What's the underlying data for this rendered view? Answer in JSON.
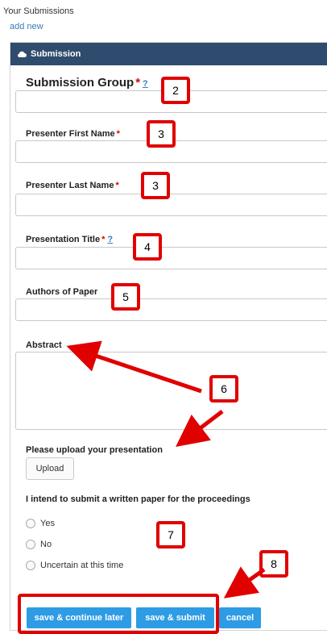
{
  "page": {
    "title": "Your Submissions",
    "add_new": "add new"
  },
  "panel": {
    "title": "Submission"
  },
  "form": {
    "submission_group": {
      "label": "Submission Group",
      "required": "*",
      "help": "?"
    },
    "first_name": {
      "label": "Presenter First Name",
      "required": "*"
    },
    "last_name": {
      "label": "Presenter Last Name",
      "required": "*"
    },
    "presentation_title": {
      "label": "Presentation Title",
      "required": "*",
      "help": "?"
    },
    "authors": {
      "label": "Authors of Paper"
    },
    "abstract": {
      "label": "Abstract"
    },
    "upload": {
      "label": "Please upload your presentation",
      "button": "Upload"
    },
    "paper_question": "I intend to submit a written paper for the proceedings",
    "options": [
      "Yes",
      "No",
      "Uncertain at this time"
    ],
    "buttons": {
      "save_continue": "save & continue later",
      "save_submit": "save & submit",
      "cancel": "cancel"
    }
  },
  "callouts": [
    "2",
    "3",
    "3",
    "4",
    "5",
    "6",
    "7",
    "8"
  ],
  "colors": {
    "header_bg": "#2f4b6d",
    "button_blue": "#2e9be5",
    "annotation_red": "#e00000"
  }
}
